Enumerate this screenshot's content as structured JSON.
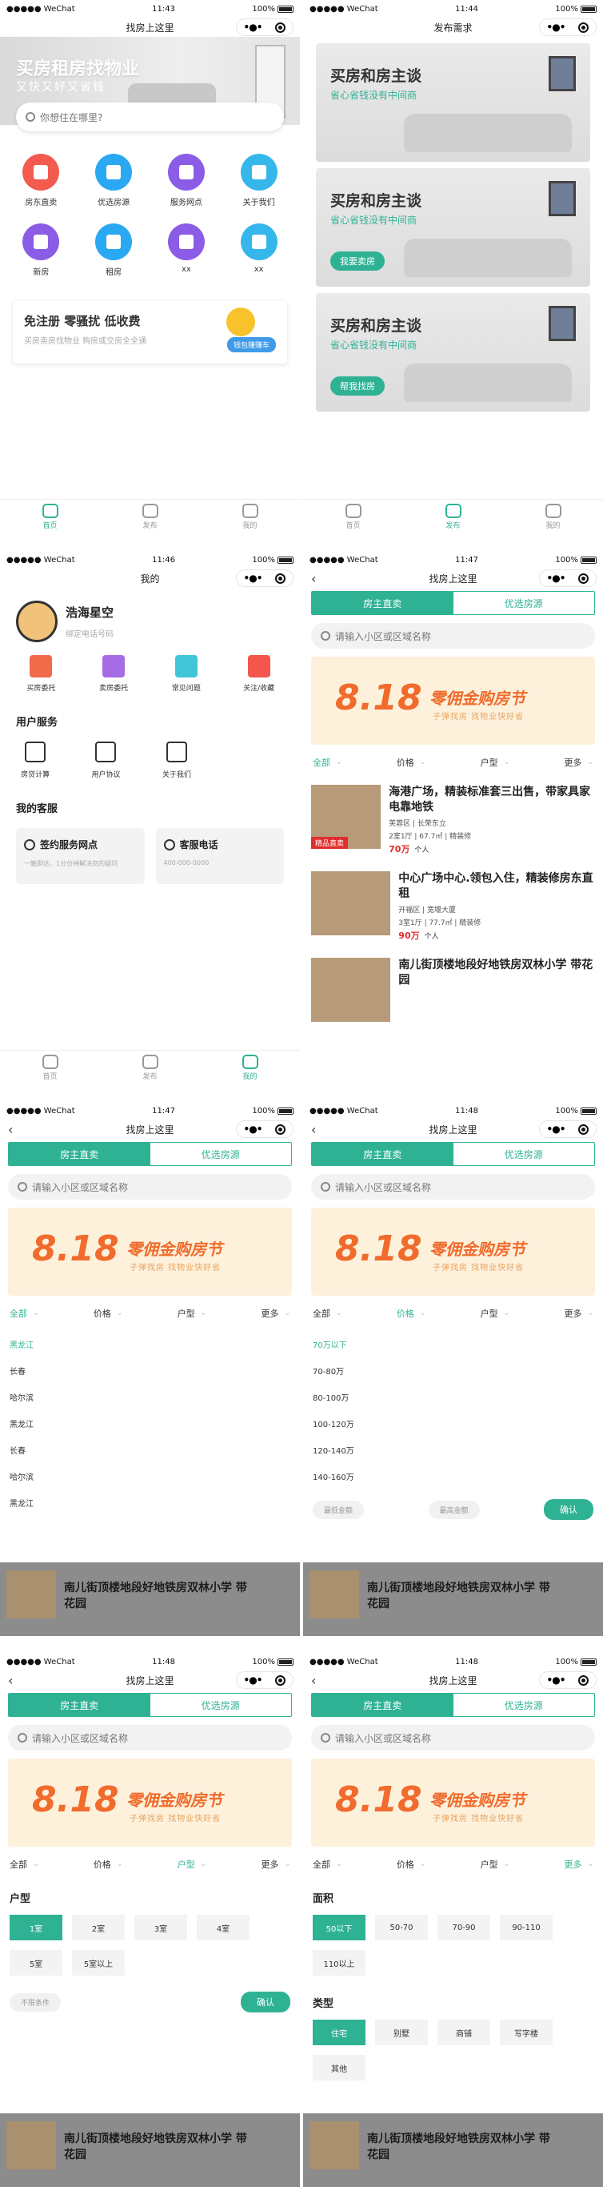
{
  "status": {
    "carrier": "●●●●● WeChat",
    "battery": "100%"
  },
  "screen1": {
    "time": "11:43",
    "title": "找房上这里",
    "hero_title": "买房租房找物业",
    "hero_sub": "又快又好又省钱",
    "search_ph": "你想住在哪里?",
    "grid": [
      {
        "label": "房东直卖",
        "color": "#f25b4d"
      },
      {
        "label": "优选房源",
        "color": "#2aa8f2"
      },
      {
        "label": "服务网点",
        "color": "#8b5ce6"
      },
      {
        "label": "关于我们",
        "color": "#36b7ec"
      },
      {
        "label": "新房",
        "color": "#8b5ce6"
      },
      {
        "label": "租房",
        "color": "#2aa8f2"
      },
      {
        "label": "xx",
        "color": "#8b5ce6"
      },
      {
        "label": "xx",
        "color": "#36b7ec"
      }
    ],
    "banner_title": "免注册 零骚扰 低收费",
    "banner_sub": "买房卖房找物业 购房或交房全全通",
    "banner_btn": "钱包赚赚车",
    "tabs": [
      "首页",
      "发布",
      "我的"
    ]
  },
  "screen2": {
    "time": "11:44",
    "title": "发布需求",
    "cards": [
      {
        "title": "买房和房主谈",
        "sub": "省心省钱没有中间商",
        "btn": ""
      },
      {
        "title": "买房和房主谈",
        "sub": "省心省钱没有中间商",
        "btn": "我要卖房"
      },
      {
        "title": "买房和房主谈",
        "sub": "省心省钱没有中间商",
        "btn": "帮我找房"
      }
    ],
    "tabs": [
      "首页",
      "发布",
      "我的"
    ]
  },
  "screen3": {
    "time": "11:46",
    "title": "我的",
    "name": "浩海星空",
    "phone": "绑定电话号码",
    "icons": [
      {
        "label": "买房委托",
        "color": "#f06b4a"
      },
      {
        "label": "卖房委托",
        "color": "#a66ce6"
      },
      {
        "label": "常见问题",
        "color": "#41c6d8"
      },
      {
        "label": "关注/收藏",
        "color": "#f2564c"
      }
    ],
    "svc_title": "用户服务",
    "svc": [
      "房贷计算",
      "用户协议",
      "关于我们"
    ],
    "kf_title": "我的客服",
    "kf": [
      {
        "title": "签约服务网点",
        "sub": "一触即达，1分分钟解决您的疑问"
      },
      {
        "title": "客服电话",
        "sub": "400-000-0000"
      }
    ],
    "tabs": [
      "首页",
      "发布",
      "我的"
    ]
  },
  "list": {
    "title": "找房上这里",
    "seg": [
      "房主直卖",
      "优选房源"
    ],
    "search_ph": "请输入小区或区域名称",
    "promo_num": "8.18",
    "promo_title": "零佣金购房节",
    "promo_sub": "子弹找房  找物业快好省",
    "filters": [
      "全部",
      "价格",
      "户型",
      "更多"
    ]
  },
  "screen4": {
    "time": "11:47",
    "houses": [
      {
        "title": "海港广场，精装标准套三出售，带家具家电靠地铁",
        "loc": "芙蓉区 | 长荣东立",
        "meta": "2室1厅 | 67.7㎡ | 精装修",
        "price": "70万",
        "owner": "个人",
        "tag": "精品直卖"
      },
      {
        "title": "中心广场中心.领包入住，精装修房东直租",
        "loc": "开福区 | 宽堰大厦",
        "meta": "3室1厅 | 77.7㎡ | 精装修",
        "price": "90万",
        "owner": "个人",
        "tag": ""
      },
      {
        "title": "南儿街顶楼地段好地铁房双林小学 带花园",
        "loc": "",
        "meta": "",
        "price": "",
        "owner": "",
        "tag": ""
      }
    ]
  },
  "screen5": {
    "time": "11:47",
    "areas": [
      "黑龙江",
      "长春",
      "哈尔滨",
      "黑龙江",
      "长春",
      "哈尔滨",
      "黑龙江"
    ],
    "dim_title": "南儿街顶楼地段好地铁房双林小学 带花园"
  },
  "screen6": {
    "time": "11:48",
    "prices": [
      "70万以下",
      "70-80万",
      "80-100万",
      "100-120万",
      "120-140万",
      "140-160万"
    ],
    "min": "最低金额",
    "max": "最高金额",
    "ok": "确认",
    "dim_title": "南儿街顶楼地段好地铁房双林小学 带花园"
  },
  "screen7": {
    "time": "11:48",
    "section": "户型",
    "rooms": [
      "1室",
      "2室",
      "3室",
      "4室",
      "5室",
      "5室以上"
    ],
    "reset": "不限条件",
    "ok": "确认",
    "dim_title": "南儿街顶楼地段好地铁房双林小学 带花园"
  },
  "screen8": {
    "time": "11:48",
    "area_title": "面积",
    "areas": [
      "50以下",
      "50-70",
      "70-90",
      "90-110",
      "110以上"
    ],
    "type_title": "类型",
    "types": [
      "住宅",
      "别墅",
      "商铺",
      "写字楼",
      "其他"
    ],
    "dim_title": "南儿街顶楼地段好地铁房双林小学 带花园"
  }
}
